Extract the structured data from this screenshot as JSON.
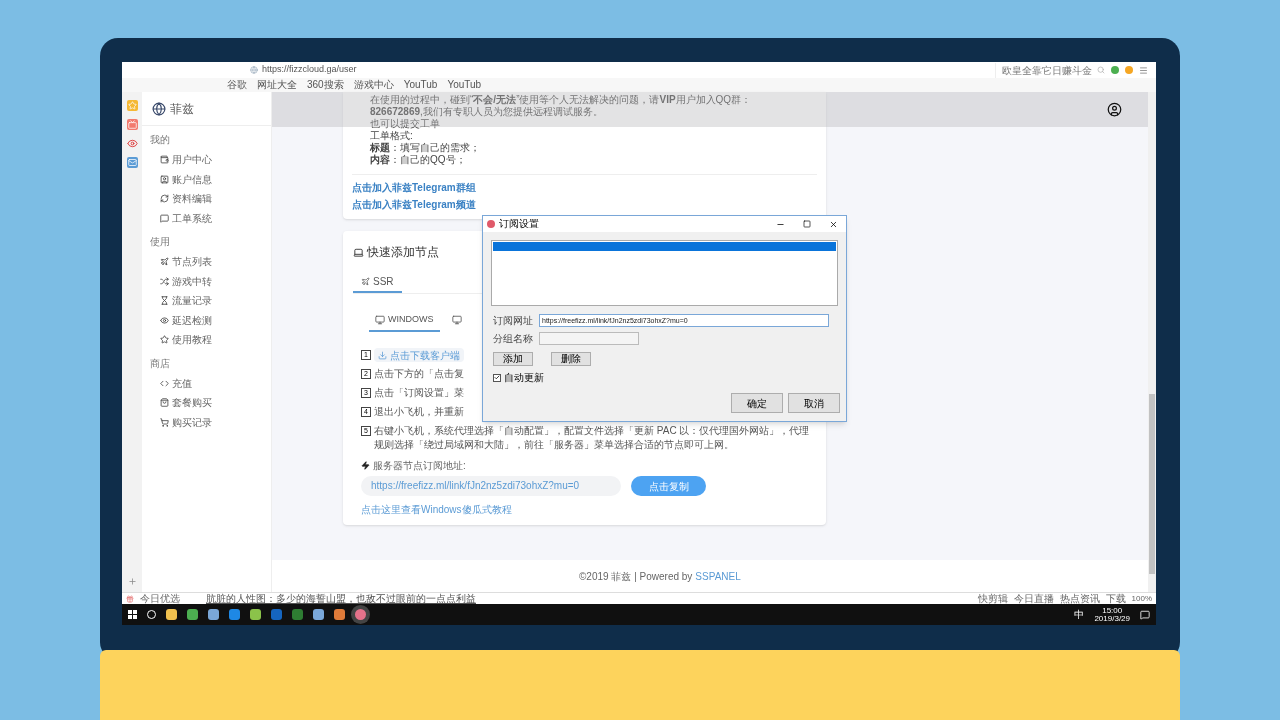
{
  "browser": {
    "url": "https://fizzcloud.ga/user",
    "search_placeholder": "欧皇全靠它日赚斗金",
    "bookmarks": [
      "谷歌",
      "网址大全",
      "360搜索",
      "游戏中心",
      "YouTub",
      "YouTub"
    ],
    "status_bar": {
      "label": "今日优选",
      "headline": "肮脏的人性图：多少的海誓山盟，也敌不过眼前的一点点利益",
      "items": [
        "快剪辑",
        "今日直播",
        "热点资讯",
        "下载"
      ],
      "zoom": "100%"
    }
  },
  "sidebar": {
    "brand": "菲兹",
    "sections": [
      {
        "title": "我的",
        "items": [
          "用户中心",
          "账户信息",
          "资料编辑",
          "工单系统"
        ]
      },
      {
        "title": "使用",
        "items": [
          "节点列表",
          "游戏中转",
          "流量记录",
          "延迟检测",
          "使用教程"
        ]
      },
      {
        "title": "商店",
        "items": [
          "充值",
          "套餐购买",
          "购买记录"
        ]
      }
    ]
  },
  "notice_card": {
    "paragraph": "在使用的过程中，碰到“**不会/无法**”使用等个人无法解决的问题，请**VIP**用户加入QQ群：**826672869**,我们有专职人员为您提供远程调试服务。",
    "lines": [
      "也可以提交工单",
      "工单格式:",
      "**标题**：填写自己的需求；",
      "**内容**：自己的QQ号；"
    ],
    "links": [
      "点击加入菲兹Telegram群组",
      "点击加入菲兹Telegram频道"
    ]
  },
  "nodes_card": {
    "title": "快速添加节点",
    "tabs": [
      {
        "label": "SSR",
        "selected": true
      }
    ],
    "platform_tabs": [
      {
        "label": "WINDOWS",
        "selected": true
      },
      {
        "selected": false
      }
    ],
    "steps": [
      {
        "number": "1",
        "kind": "button",
        "text": "点击下载客户端"
      },
      {
        "number": "2",
        "kind": "text",
        "text": "点击下方的「点击复"
      },
      {
        "number": "3",
        "kind": "text",
        "text": "点击「订阅设置」菜"
      },
      {
        "number": "4",
        "kind": "text",
        "text": "退出小飞机，并重新"
      },
      {
        "number": "5",
        "kind": "text",
        "text": "右键小飞机，系统代理选择「自动配置」，配置文件选择「更新 PAC 以：仅代理国外网站」，代理规则选择「绕过局域网和大陆」，前往「服务器」菜单选择合适的节点即可上网。"
      }
    ],
    "subscription": {
      "label": "服务器节点订阅地址:",
      "value": "https://freefizz.ml/link/fJn2nz5zdi73ohxZ?mu=0",
      "button": "点击复制"
    },
    "tutorial_link": "点击这里查看Windows傻瓜式教程"
  },
  "footer": {
    "text": "©2019 菲兹 | Powered by",
    "link": "SSPANEL"
  },
  "dialog": {
    "title": "订阅设置",
    "list_rows": [
      {
        "selected": true
      }
    ],
    "fields": [
      {
        "label": "订阅网址",
        "value": "https://freefizz.ml/link/fJn2nz5zdi73ohxZ?mu=0"
      },
      {
        "label": "分组名称"
      }
    ],
    "buttons": [
      "添加",
      "删除"
    ],
    "auto_update": {
      "label": "自动更新",
      "checked": true
    },
    "actions": [
      "确定",
      "取消"
    ]
  },
  "taskbar": {
    "ime": "中",
    "time": "15:00",
    "date": "2019/3/29"
  }
}
